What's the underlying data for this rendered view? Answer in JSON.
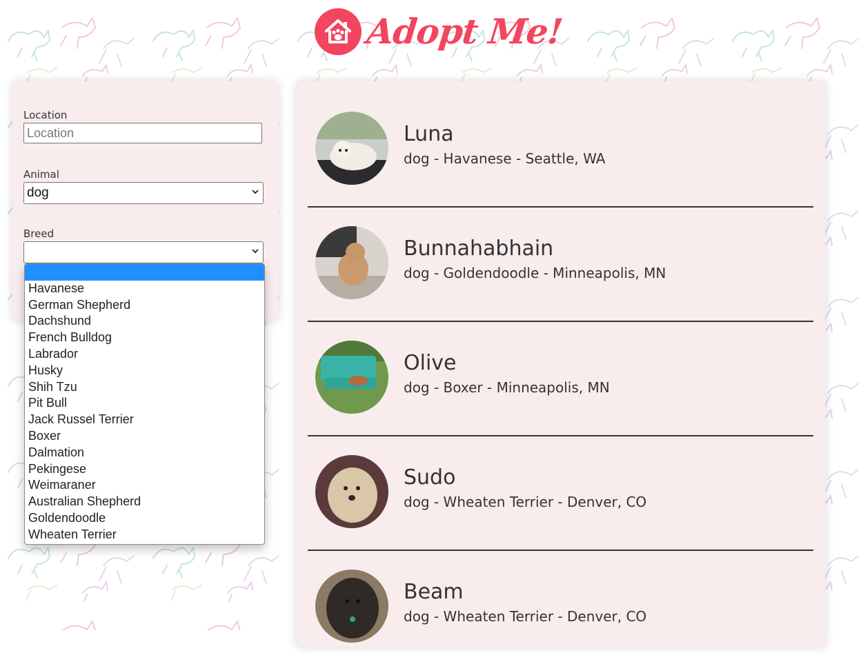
{
  "header": {
    "title": "Adopt Me!",
    "logo_icon": "house-paw-icon",
    "brand_color": "#f2455f"
  },
  "search": {
    "location_label": "Location",
    "location_value": "",
    "location_placeholder": "Location",
    "animal_label": "Animal",
    "animal_value": "dog",
    "breed_label": "Breed",
    "breed_value": ""
  },
  "breed_options": [
    "",
    "Havanese",
    "German Shepherd",
    "Dachshund",
    "French Bulldog",
    "Labrador",
    "Husky",
    "Shih Tzu",
    "Pit Bull",
    "Jack Russel Terrier",
    "Boxer",
    "Dalmation",
    "Pekingese",
    "Weimaraner",
    "Australian Shepherd",
    "Goldendoodle",
    "Wheaten Terrier"
  ],
  "pets": [
    {
      "name": "Luna",
      "description": "dog - Havanese - Seattle, WA"
    },
    {
      "name": "Bunnahabhain",
      "description": "dog - Goldendoodle - Minneapolis, MN"
    },
    {
      "name": "Olive",
      "description": "dog - Boxer - Minneapolis, MN"
    },
    {
      "name": "Sudo",
      "description": "dog - Wheaten Terrier - Denver, CO"
    },
    {
      "name": "Beam",
      "description": "dog - Wheaten Terrier - Denver, CO"
    }
  ],
  "colors": {
    "panel_bg": "#f8eced",
    "selected_option": "#1e90ff"
  }
}
